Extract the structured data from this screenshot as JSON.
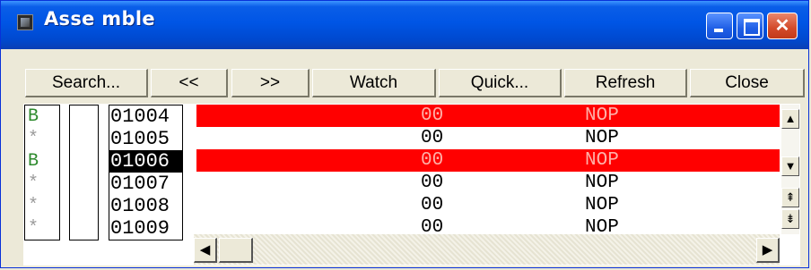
{
  "window": {
    "title": "Asse mble"
  },
  "titlebar": {
    "icon": "app-window-icon",
    "min_icon": "minimize-icon",
    "max_icon": "maximize-icon",
    "close_icon": "close-icon",
    "close_color": "#d34a2a"
  },
  "toolbar": {
    "search": "Search...",
    "prev": "<<",
    "next": ">>",
    "watch": "Watch",
    "quick": "Quick...",
    "refresh": "Refresh",
    "close": "Close"
  },
  "rows": [
    {
      "status": "B",
      "address": "01004",
      "code": "00",
      "mnemonic": "NOP",
      "breakpoint": true,
      "selected": false
    },
    {
      "status": "*",
      "address": "01005",
      "code": "00",
      "mnemonic": "NOP",
      "breakpoint": false,
      "selected": false
    },
    {
      "status": "B",
      "address": "01006",
      "code": "00",
      "mnemonic": "NOP",
      "breakpoint": true,
      "selected": true
    },
    {
      "status": "*",
      "address": "01007",
      "code": "00",
      "mnemonic": "NOP",
      "breakpoint": false,
      "selected": false
    },
    {
      "status": "*",
      "address": "01008",
      "code": "00",
      "mnemonic": "NOP",
      "breakpoint": false,
      "selected": false
    },
    {
      "status": "*",
      "address": "01009",
      "code": "00",
      "mnemonic": "NOP",
      "breakpoint": false,
      "selected": false
    }
  ],
  "colors": {
    "breakpoint": "#ff0000",
    "status_b": "#2d8a2d",
    "selection": "#000000",
    "titlebar": "#0055e5"
  },
  "scroll": {
    "up": "▲",
    "down": "▼",
    "page_up": "⇞",
    "page_down": "⇟",
    "left": "◀",
    "right": "▶"
  }
}
